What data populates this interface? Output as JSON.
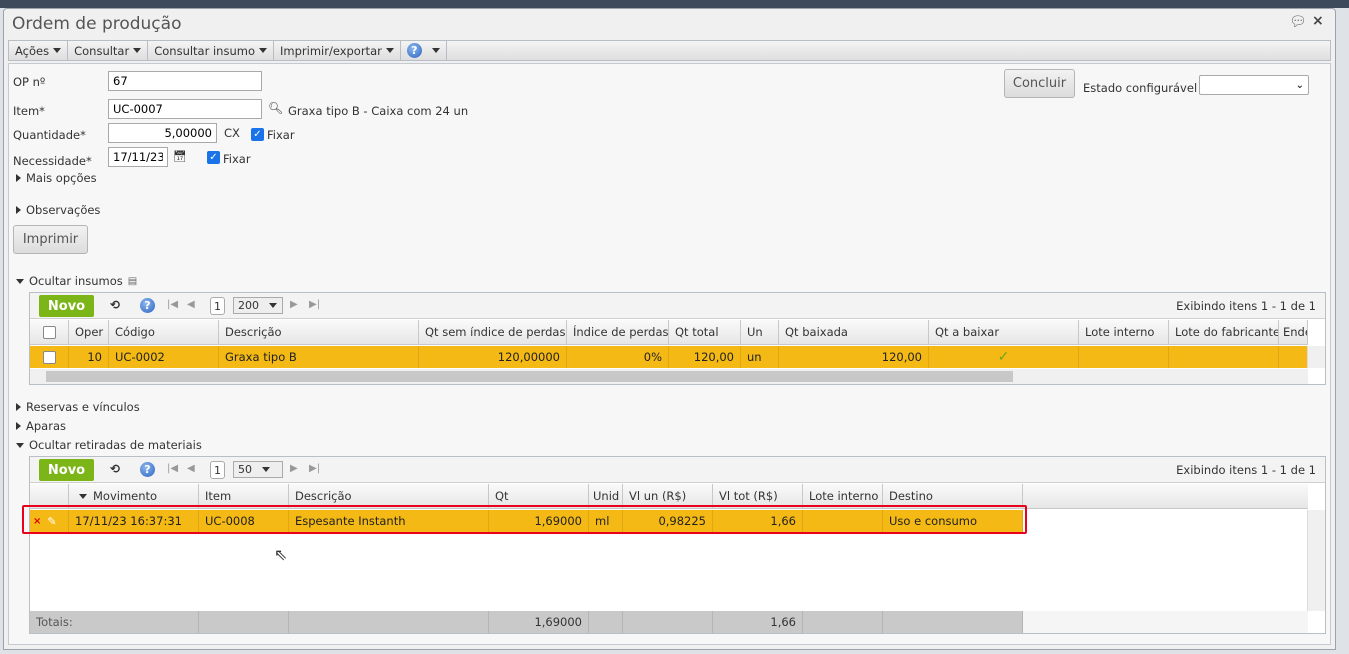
{
  "window": {
    "title": "Ordem de produção"
  },
  "toolbar": {
    "acoes": "Ações",
    "consultar": "Consultar",
    "consultar_insumo": "Consultar insumo",
    "imprimir": "Imprimir/exportar",
    "help": "?"
  },
  "form": {
    "op_label": "OP nº",
    "op_value": "67",
    "item_label": "Item*",
    "item_value": "UC-0007",
    "item_desc": "Graxa tipo B - Caixa com 24 un",
    "qtd_label": "Quantidade*",
    "qtd_value": "5,00000",
    "qtd_unit": "CX",
    "fixar": "Fixar",
    "nec_label": "Necessidade*",
    "nec_value": "17/11/23",
    "mais_opcoes": "Mais opções",
    "observacoes": "Observações",
    "imprimir": "Imprimir",
    "concluir": "Concluir",
    "estado_label": "Estado configurável",
    "estado_value": ""
  },
  "insumos": {
    "toggle": "Ocultar insumos",
    "novo": "Novo",
    "page": "1",
    "page_size": "200",
    "info": "Exibindo itens 1 - 1 de 1",
    "columns": [
      "Oper",
      "Código",
      "Descrição",
      "Qt sem índice de perdas",
      "Índice de perdas",
      "Qt total",
      "Un",
      "Qt baixada",
      "Qt a baixar",
      "Lote interno",
      "Lote do fabricante",
      "Endereço"
    ],
    "rows": [
      {
        "oper": "10",
        "codigo": "UC-0002",
        "descricao": "Graxa tipo B",
        "qt_sem": "120,00000",
        "indice": "0%",
        "qt_total": "120,00",
        "un": "un",
        "qt_baixada": "120,00",
        "qt_a_baixar": "✓"
      }
    ]
  },
  "sections": {
    "reservas": "Reservas e vínculos",
    "aparas": "Aparas",
    "retiradas": "Ocultar retiradas de materiais"
  },
  "retiradas": {
    "novo": "Novo",
    "page": "1",
    "page_size": "50",
    "info": "Exibindo itens 1 - 1 de 1",
    "columns": [
      "Movimento",
      "Item",
      "Descrição",
      "Qt",
      "Unid",
      "Vl un (R$)",
      "Vl tot (R$)",
      "Lote interno",
      "Destino"
    ],
    "rows": [
      {
        "movimento": "17/11/23 16:37:31",
        "item": "UC-0008",
        "descricao": "Espesante Instanth",
        "qt": "1,69000",
        "unid": "ml",
        "vl_un": "0,98225",
        "vl_tot": "1,66",
        "lote": "",
        "destino": "Uso e consumo"
      }
    ],
    "totals": {
      "label": "Totais:",
      "qt": "1,69000",
      "vl_tot": "1,66"
    }
  },
  "colors": {
    "highlight": "#f4b914",
    "novo": "#7cb518",
    "selection_border": "#e8001c"
  }
}
